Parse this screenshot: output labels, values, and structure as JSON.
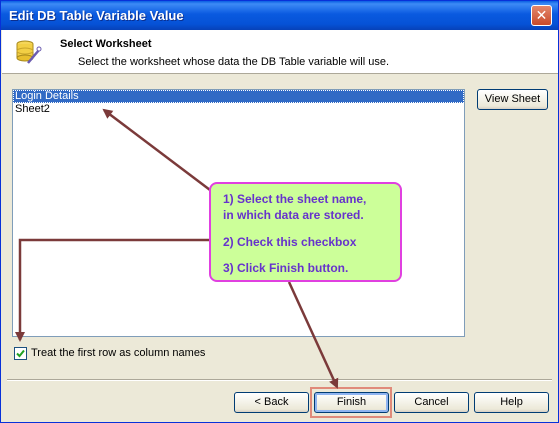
{
  "window": {
    "title": "Edit DB Table Variable Value",
    "close_glyph": "✕"
  },
  "header": {
    "title": "Select Worksheet",
    "subtitle": "Select the worksheet whose data the DB Table variable will use."
  },
  "worksheets": {
    "items": [
      "Login Details",
      "Sheet2"
    ],
    "selected": "Login Details"
  },
  "buttons": {
    "view_sheet": "View Sheet",
    "back": "< Back",
    "finish": "Finish",
    "cancel": "Cancel",
    "help": "Help"
  },
  "checkbox": {
    "label": "Treat the first row as column names",
    "checked": true
  },
  "callout": {
    "step1_line1": "1) Select the sheet name,",
    "step1_line2": "in which data are stored.",
    "step2": "2) Check this checkbox",
    "step3": "3) Click Finish button."
  },
  "colors": {
    "selection": "#316ac5",
    "callout_fill": "#ccff99",
    "callout_border": "#e040e0",
    "callout_text": "#6633cc",
    "arrow": "#7b3a3a"
  }
}
